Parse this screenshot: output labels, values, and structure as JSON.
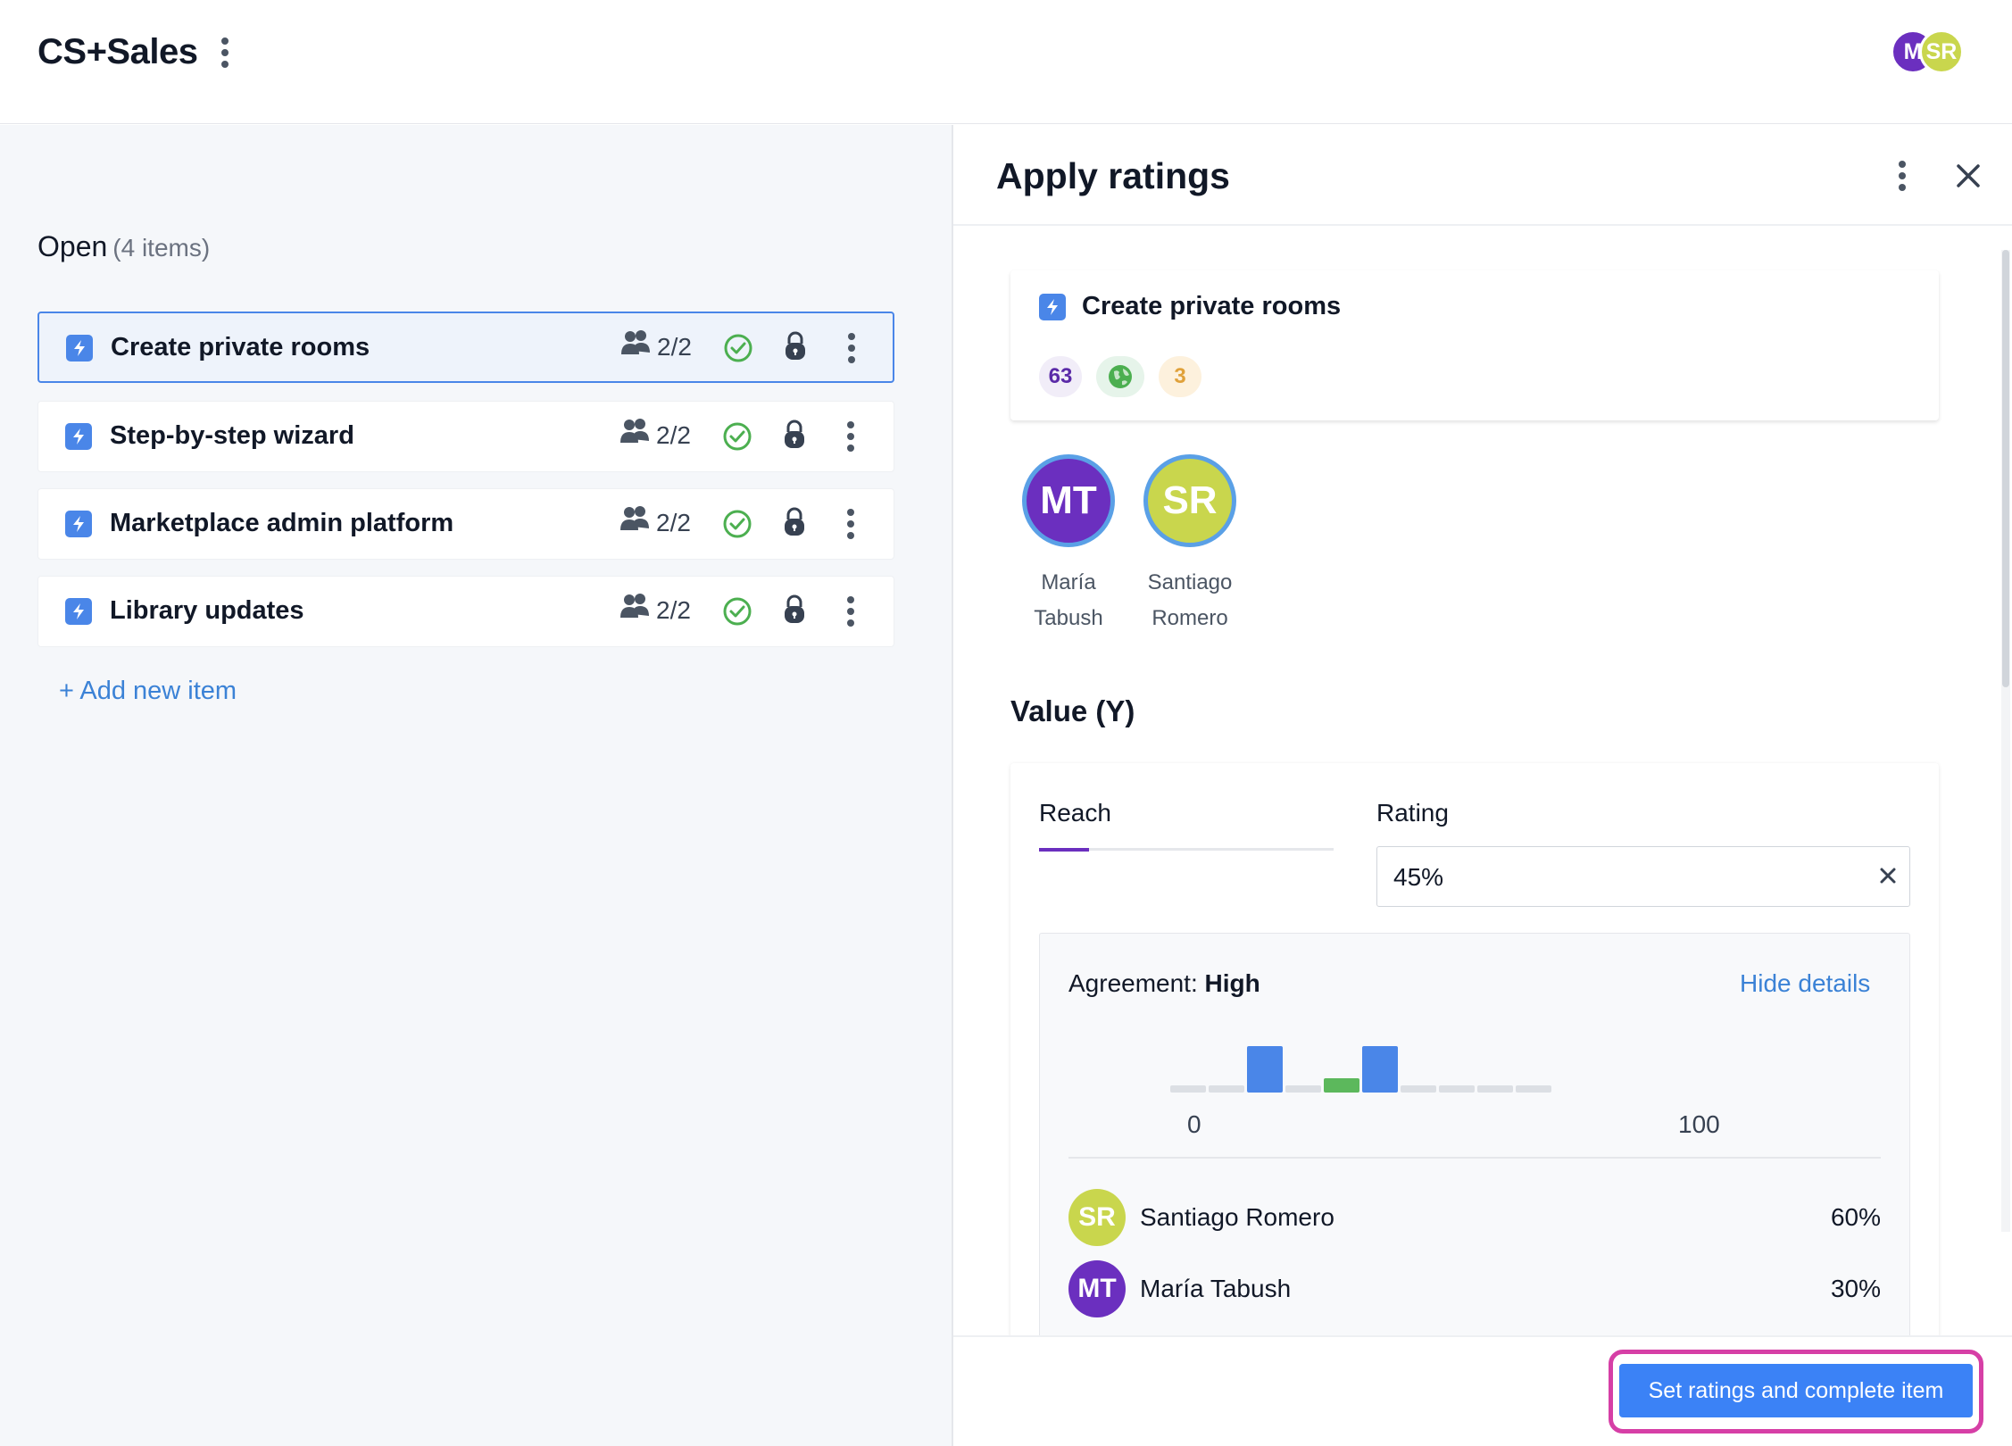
{
  "header": {
    "app_title": "CS+Sales",
    "avatars": [
      {
        "initials": "M",
        "color": "#6b2fbf"
      },
      {
        "initials": "SR",
        "color": "#c9d64d"
      }
    ]
  },
  "left": {
    "section_title": "Open",
    "section_count": "(4 items)",
    "items": [
      {
        "label": "Create private rooms",
        "count": "2/2",
        "selected": true
      },
      {
        "label": "Step-by-step wizard",
        "count": "2/2",
        "selected": false
      },
      {
        "label": "Marketplace admin platform",
        "count": "2/2",
        "selected": false
      },
      {
        "label": "Library updates",
        "count": "2/2",
        "selected": false
      }
    ],
    "add_item": "+ Add new item"
  },
  "panel": {
    "title": "Apply ratings",
    "card": {
      "title": "Create private rooms",
      "score": "63",
      "number": "3"
    },
    "raters": [
      {
        "initials": "MT",
        "first": "María",
        "last": "Tabush",
        "color": "#6b2fbf"
      },
      {
        "initials": "SR",
        "first": "Santiago",
        "last": "Romero",
        "color": "#c9d64d"
      }
    ],
    "value_title": "Value (Y)",
    "tab_label": "Reach",
    "rating_label": "Rating",
    "rating_value": "45%",
    "agreement_label": "Agreement:",
    "agreement_value": "High",
    "hide_details": "Hide details",
    "tick_min": "0",
    "tick_max": "100",
    "ratings": [
      {
        "initials": "SR",
        "name": "Santiago Romero",
        "value": "60%",
        "color": "#c9d64d"
      },
      {
        "initials": "MT",
        "name": "María Tabush",
        "value": "30%",
        "color": "#6b2fbf"
      }
    ],
    "cta": "Set ratings and complete item"
  },
  "colors": {
    "accent": "#4a86e8",
    "link": "#3b82d6",
    "highlight_frame": "#d63fa6",
    "bar_rating": "#4a86e8",
    "bar_average": "#5cb85c",
    "bar_empty": "#dcdfe4"
  },
  "icons": [
    "kebab-icon",
    "people-icon",
    "check-circle-icon",
    "lock-icon",
    "lightning-icon",
    "globe-icon",
    "close-icon"
  ]
}
